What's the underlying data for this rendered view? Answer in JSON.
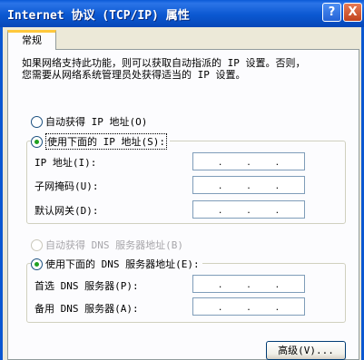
{
  "window": {
    "title": "Internet 协议 (TCP/IP) 属性",
    "help_label": "?",
    "close_label": "X"
  },
  "tab": {
    "label": "常规"
  },
  "description": {
    "line1": "如果网络支持此功能，则可以获取自动指派的 IP 设置。否则，",
    "line2": "您需要从网络系统管理员处获得适当的 IP 设置。"
  },
  "ip_section": {
    "auto_label": "自动获得 IP 地址(O)",
    "manual_label": "使用下面的 IP 地址(S):",
    "selected": "manual",
    "fields": [
      {
        "label": "IP 地址(I):",
        "value": ""
      },
      {
        "label": "子网掩码(U):",
        "value": ""
      },
      {
        "label": "默认网关(D):",
        "value": ""
      }
    ]
  },
  "dns_section": {
    "auto_label": "自动获得 DNS 服务器地址(B)",
    "manual_label": "使用下面的 DNS 服务器地址(E):",
    "selected": "manual",
    "fields": [
      {
        "label": "首选 DNS 服务器(P):",
        "value": ""
      },
      {
        "label": "备用 DNS 服务器(A):",
        "value": ""
      }
    ]
  },
  "buttons": {
    "advanced_label": "高级(V)..."
  },
  "colors": {
    "titlebar": "#0b58d1",
    "window_bg": "#ece9d8",
    "panel_bg": "#fcfcfe",
    "tab_accent": "#ffc83c",
    "radio_dot": "#21a121",
    "disabled_text": "#a7a6aa"
  },
  "icons": {
    "help": "help-icon",
    "close": "close-icon",
    "radio": "radio-button-icon"
  }
}
